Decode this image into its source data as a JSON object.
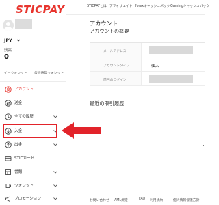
{
  "brand": {
    "logo_text": "STICPAY",
    "logo_color": "#e8352e"
  },
  "top_nav": [
    "STICPAYとは",
    "アフィリエイト",
    "Forexキャッシュバック",
    "Gamingキャッシュバック"
  ],
  "user": {
    "currency": "JPY",
    "balance_label": "残高",
    "balance_value": "0",
    "deposit_wallet_label": "イーウォレット",
    "secure_wallet_label": "仮想通貨ウォレット"
  },
  "sidebar": {
    "items": [
      {
        "label": "アカウント",
        "icon": "account-icon",
        "active": true,
        "has_chevron": false
      },
      {
        "label": "送金",
        "icon": "transfer-icon",
        "active": false,
        "has_chevron": false
      },
      {
        "label": "全ての履歴",
        "icon": "history-icon",
        "active": false,
        "has_chevron": true
      },
      {
        "label": "入金",
        "icon": "deposit-icon",
        "active": false,
        "has_chevron": true
      },
      {
        "label": "出金",
        "icon": "withdraw-icon",
        "active": false,
        "has_chevron": true
      },
      {
        "label": "STICカード",
        "icon": "card-icon",
        "active": false,
        "has_chevron": false
      },
      {
        "label": "書類",
        "icon": "documents-icon",
        "active": false,
        "has_chevron": true
      },
      {
        "label": "ウォレット",
        "icon": "wallet-icon",
        "active": false,
        "has_chevron": true
      },
      {
        "label": "プロモーション",
        "icon": "promotion-icon",
        "active": false,
        "has_chevron": true
      }
    ]
  },
  "main": {
    "page_title": "アカウント",
    "overview_title": "アカウントの概要",
    "account_rows": [
      {
        "label": "メールアドレス",
        "value": "",
        "masked": true
      },
      {
        "label": "アカウントタイプ",
        "value": "個人",
        "masked": false
      },
      {
        "label": "前回のログイン",
        "value": "",
        "masked": true
      }
    ],
    "recent_title": "最近の取引履歴"
  },
  "footer": [
    "お問い合わせ",
    "AML規定",
    "FAQ",
    "利用規約",
    "個人情報保護方針"
  ],
  "colors": {
    "accent": "#e8352e",
    "annotation": "#e2232a"
  }
}
